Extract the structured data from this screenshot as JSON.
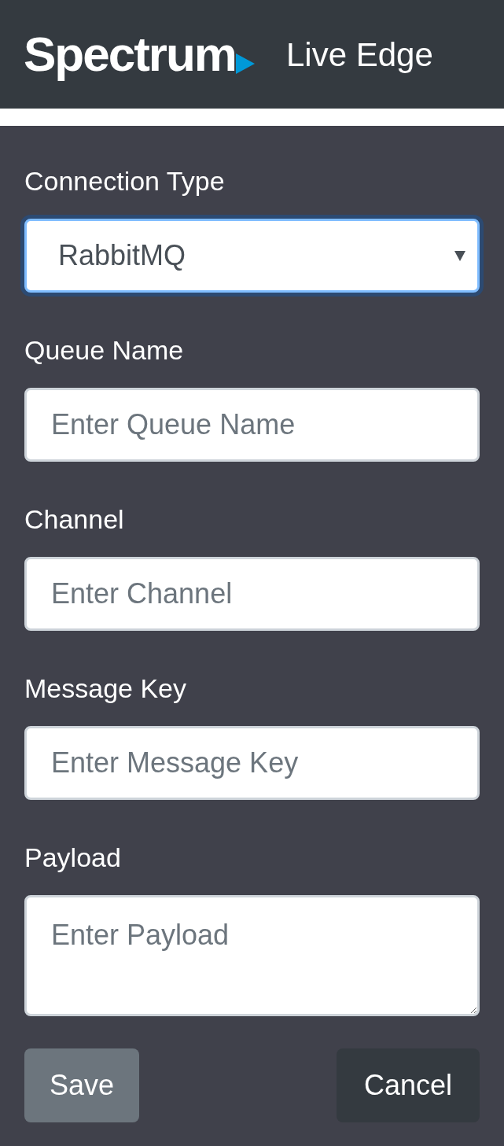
{
  "header": {
    "logo": "Spectrum",
    "title": "Live Edge"
  },
  "fields": [
    {
      "kind": "select",
      "label": "Connection Type",
      "value": "RabbitMQ",
      "focused": true
    },
    {
      "kind": "input",
      "label": "Queue Name",
      "placeholder": "Enter Queue Name",
      "focused": false
    },
    {
      "kind": "input",
      "label": "Channel",
      "placeholder": "Enter Channel",
      "focused": false
    },
    {
      "kind": "input",
      "label": "Message Key",
      "placeholder": "Enter Message Key",
      "focused": false
    },
    {
      "kind": "textarea",
      "label": "Payload",
      "placeholder": "Enter Payload",
      "focused": false
    }
  ],
  "buttons": [
    {
      "kind": "secondary",
      "label": "Save"
    },
    {
      "kind": "dark",
      "label": "Cancel"
    }
  ]
}
